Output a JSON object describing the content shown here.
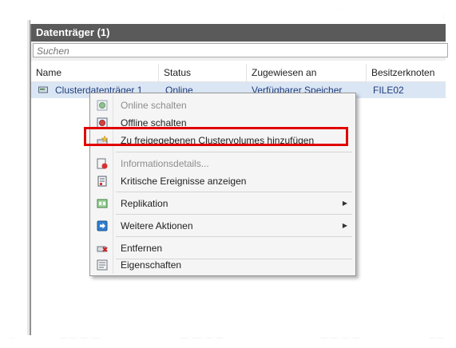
{
  "panel": {
    "title": "Datenträger (1)"
  },
  "search": {
    "placeholder": "Suchen"
  },
  "columns": [
    "Name",
    "Status",
    "Zugewiesen an",
    "Besitzerknoten"
  ],
  "row": {
    "name": "Clusterdatenträger 1",
    "status": "Online",
    "assigned": "Verfügbarer Speicher",
    "owner": "FILE02"
  },
  "menu": {
    "items": [
      {
        "label": "Online schalten",
        "icon": "online-icon",
        "enabled": false
      },
      {
        "label": "Offline schalten",
        "icon": "offline-icon",
        "enabled": true
      },
      {
        "label": "Zu freigegebenen Clustervolumes hinzufügen",
        "icon": "csv-add-icon",
        "enabled": true
      },
      {
        "label": "Informationsdetails...",
        "icon": "info-details-icon",
        "enabled": false
      },
      {
        "label": "Kritische Ereignisse anzeigen",
        "icon": "critical-events-icon",
        "enabled": true
      },
      {
        "label": "Replikation",
        "icon": "replication-icon",
        "enabled": true,
        "submenu": true
      },
      {
        "label": "Weitere Aktionen",
        "icon": "more-actions-icon",
        "enabled": true,
        "submenu": true
      },
      {
        "label": "Entfernen",
        "icon": "remove-icon",
        "enabled": true
      },
      {
        "label": "Eigenschaften",
        "icon": "properties-icon",
        "enabled": true
      }
    ]
  },
  "colors": {
    "title_bar": "#5a5a5a",
    "selected_row": "#dbe6f5",
    "highlight": "#e00000"
  }
}
